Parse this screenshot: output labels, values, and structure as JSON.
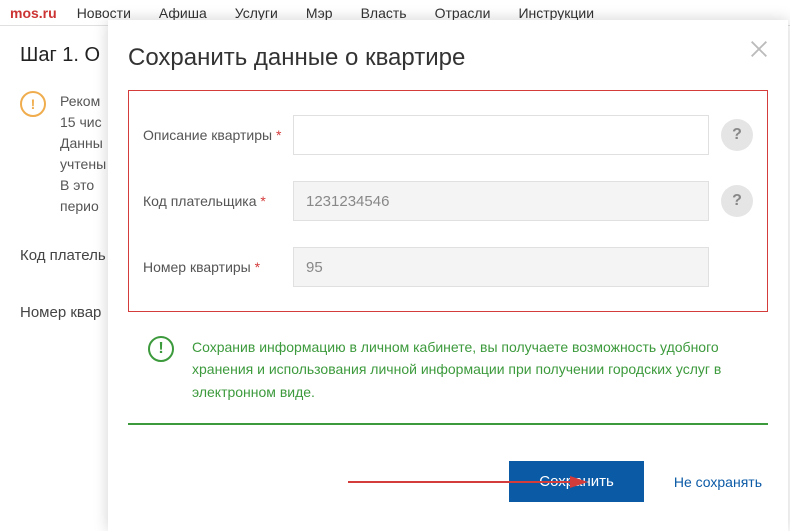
{
  "logo": "mos.ru",
  "nav": {
    "news": "Новости",
    "afisha": "Афиша",
    "services": "Услуги",
    "mayor": "Мэр",
    "power": "Власть",
    "branches": "Отрасли",
    "instructions": "Инструкции"
  },
  "bg": {
    "step_title": "Шаг 1. О",
    "info_text": "Реком\n15 чис\nДанны\nучтены\nВ это\nперио",
    "label_payer": "Код платель",
    "label_apartment": "Номер квар"
  },
  "modal": {
    "title": "Сохранить данные о квартире",
    "labels": {
      "description": "Описание квартиры",
      "payer_code": "Код плательщика",
      "apartment_no": "Номер квартиры",
      "required": "*"
    },
    "values": {
      "description": "",
      "payer_code": "1231234546",
      "apartment_no": "95"
    },
    "help": "?",
    "tip": "Сохранив информацию в личном кабинете, вы получаете возможность удобного хранения и использования личной информации при получении городских услуг в электронном виде.",
    "save": "Сохранить",
    "dont_save": "Не сохранять"
  }
}
